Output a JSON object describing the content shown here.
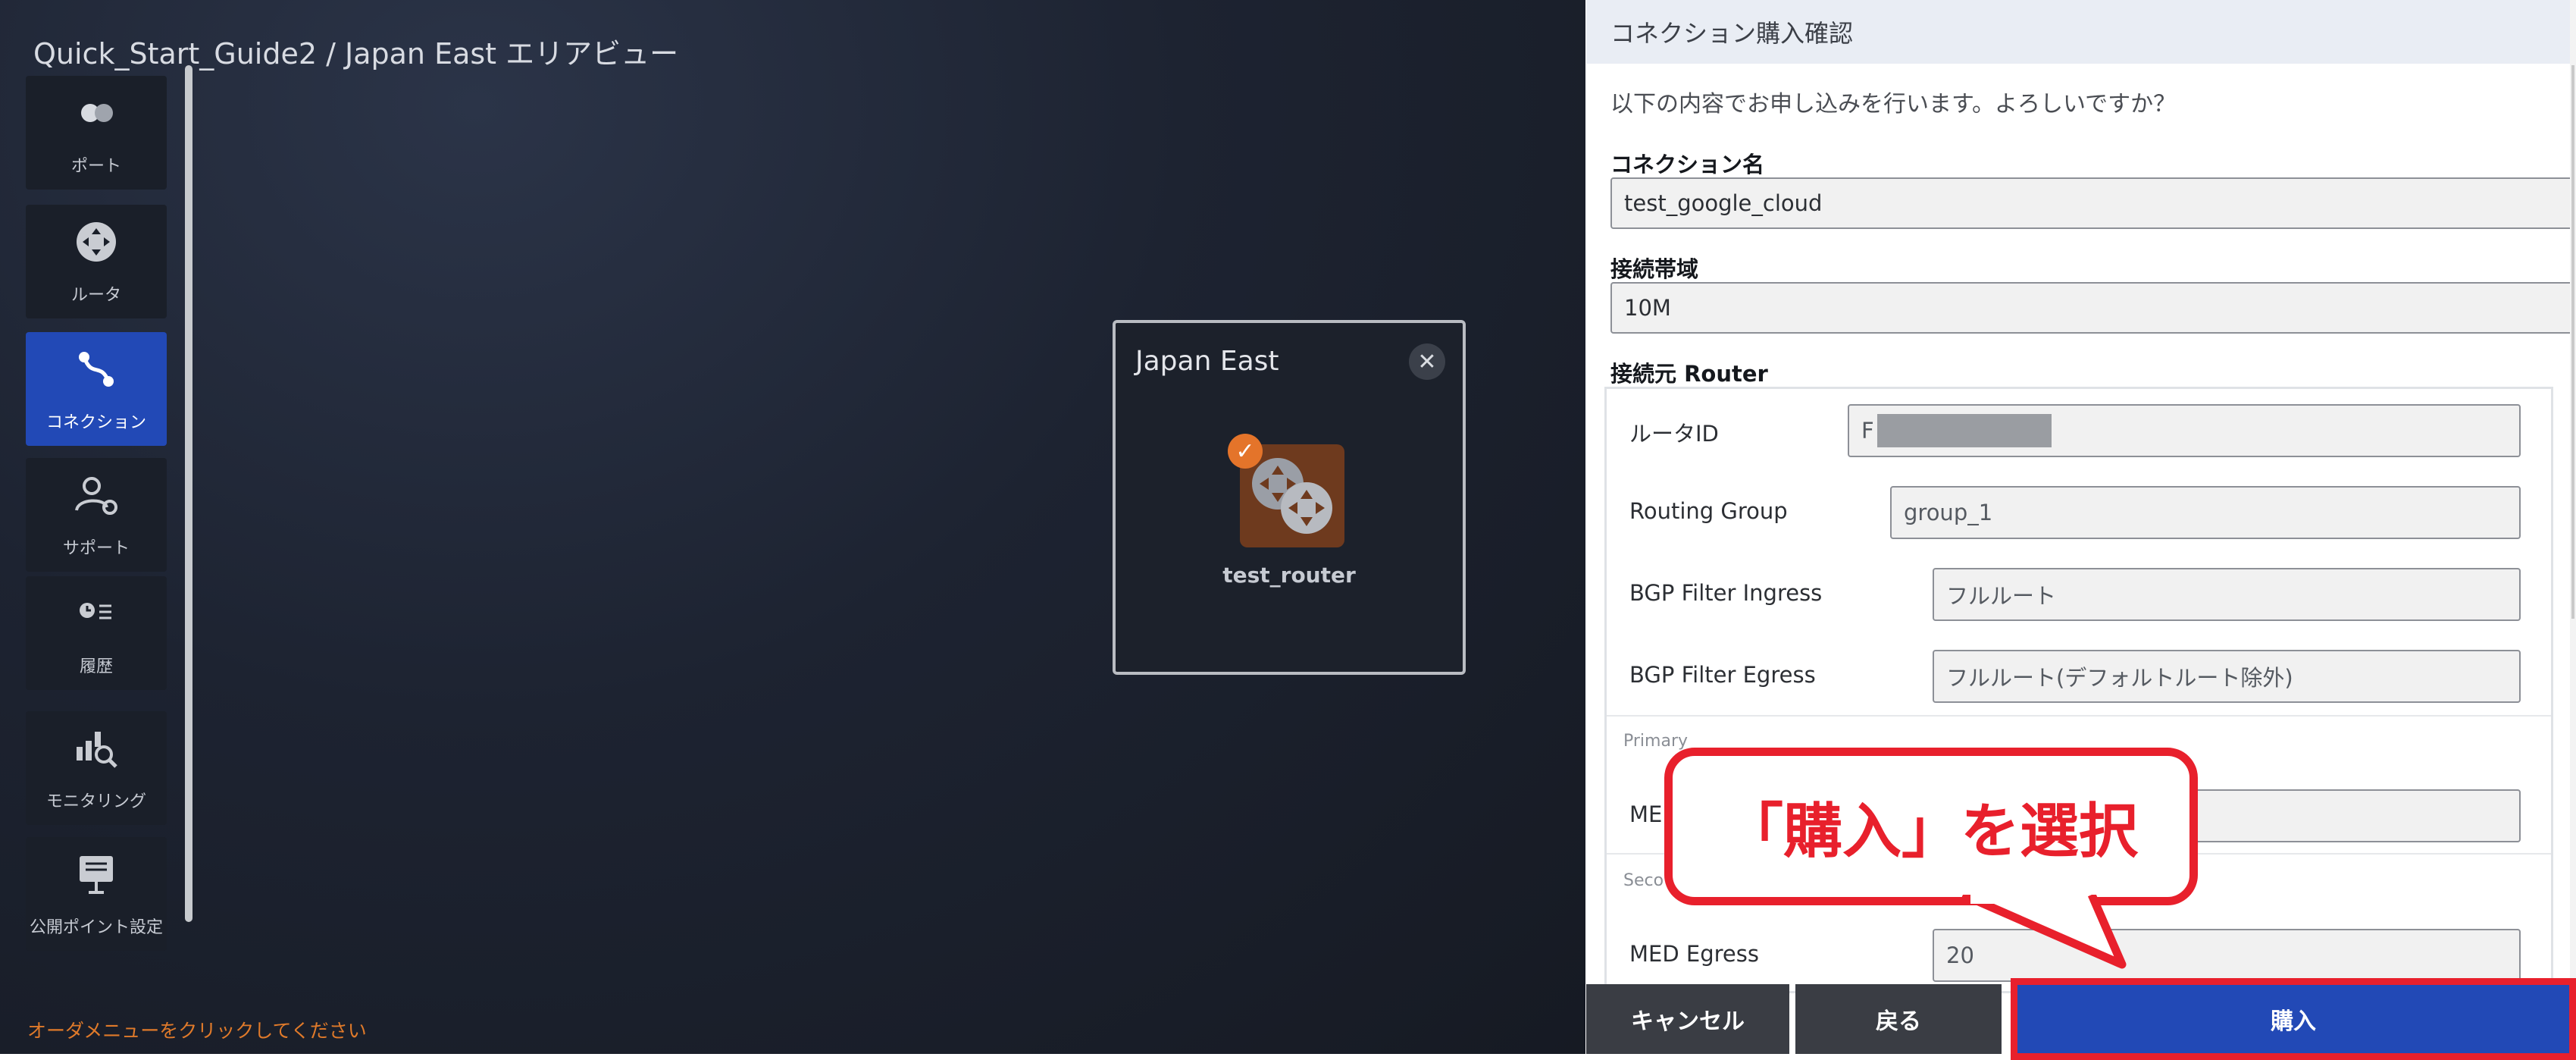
{
  "page": {
    "title": "Quick_Start_Guide2 / Japan East エリアビュー",
    "footer_note": "オーダメニューをクリックしてください"
  },
  "sidebar": {
    "items": [
      {
        "label": "ポート",
        "icon": "port-icon",
        "active": false
      },
      {
        "label": "ルータ",
        "icon": "router-icon",
        "active": false
      },
      {
        "label": "コネクション",
        "icon": "connection-icon",
        "active": true
      },
      {
        "label": "サポート",
        "icon": "support-icon",
        "active": false
      },
      {
        "label": "履歴",
        "icon": "history-icon",
        "active": false
      },
      {
        "label": "モニタリング",
        "icon": "monitoring-icon",
        "active": false
      },
      {
        "label": "公開ポイント設定",
        "icon": "public-point-icon",
        "active": false
      }
    ]
  },
  "area": {
    "title": "Japan East",
    "router_label": "test_router",
    "close_icon": "close-icon"
  },
  "panel": {
    "header": "コネクション購入確認",
    "message": "以下の内容でお申し込みを行います。よろしいですか？",
    "connection_name_label": "コネクション名",
    "connection_name_value": "test_google_cloud",
    "bandwidth_label": "接続帯域",
    "bandwidth_value": "10M",
    "source_router_label": "接続元 Router",
    "router_id_label": "ルータID",
    "router_id_value": "F",
    "routing_group_label": "Routing Group",
    "routing_group_value": "group_1",
    "bgp_ingress_label": "BGP Filter Ingress",
    "bgp_ingress_value": "フルルート",
    "bgp_egress_label": "BGP Filter Egress",
    "bgp_egress_value": "フルルート(デフォルトルート除外)",
    "primary_label": "Primary",
    "primary_med_label": "ME",
    "secondary_label": "Seco",
    "med_egress_label": "MED Egress",
    "med_egress_value": "20"
  },
  "buttons": {
    "cancel": "キャンセル",
    "back": "戻る",
    "buy": "購入"
  },
  "callout": {
    "text": "「購入」を選択",
    "color": "#e8202c"
  },
  "colors": {
    "accent": "#2249b6",
    "highlight": "#e8202c",
    "router": "#6e3a1e",
    "check": "#e4742a"
  }
}
